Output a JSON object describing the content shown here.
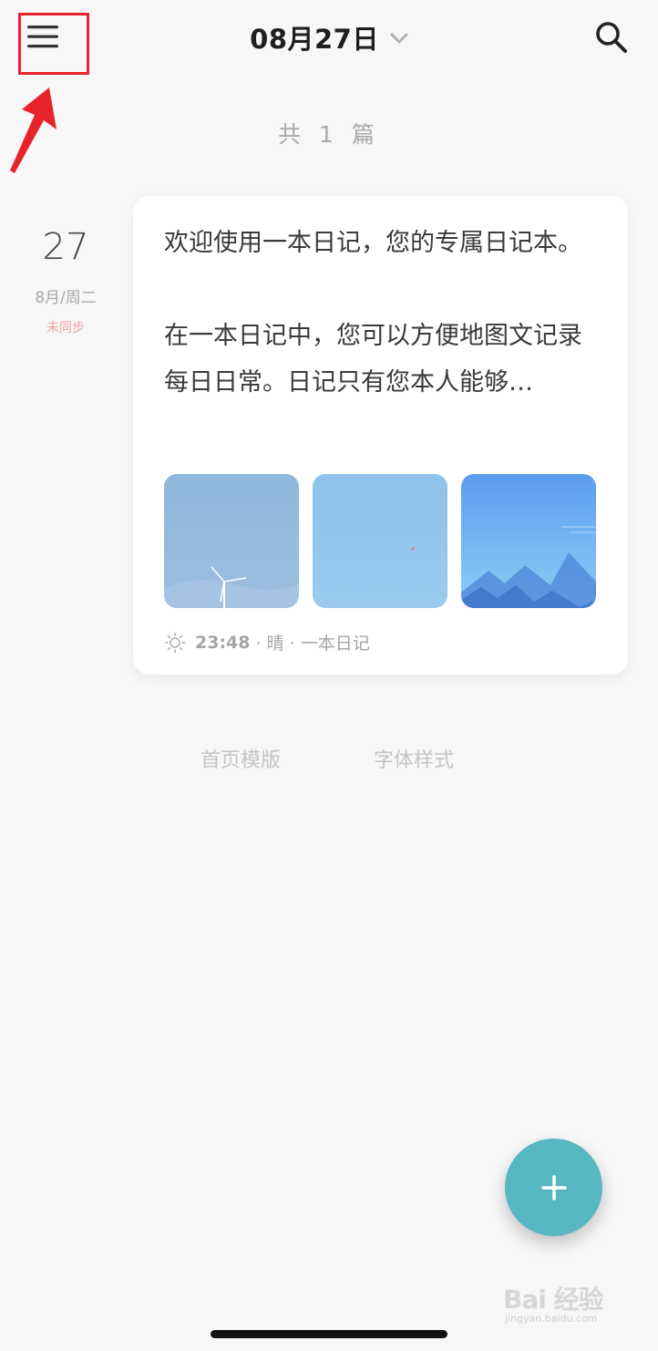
{
  "header": {
    "date_title": "08月27日",
    "menu_icon": "hamburger-menu-icon",
    "dropdown_icon": "chevron-down-icon",
    "search_icon": "search-icon",
    "highlight_color": "#e8222b"
  },
  "summary": {
    "count_text": "共 1 篇"
  },
  "entry": {
    "day": "27",
    "month_weekday": "8月/周二",
    "sync_status": "未同步",
    "text": "欢迎使用一本日记，您的专属日记本。\n\n在一本日记中，您可以方便地图文记录每日日常。日记只有您本人能够…",
    "images": [
      "wind-turbine-sky-photo",
      "blue-sky-photo",
      "blue-mountains-illustration"
    ],
    "weather_icon": "sun-icon",
    "time": "23:48",
    "meta": " · 晴 · 一本日记"
  },
  "footer_links": {
    "template": "首页模版",
    "font_style": "字体样式"
  },
  "fab": {
    "icon": "plus-icon",
    "color": "#56b6c2"
  },
  "watermark": {
    "main": "Bai 经验",
    "sub": "jingyan.baidu.com"
  }
}
